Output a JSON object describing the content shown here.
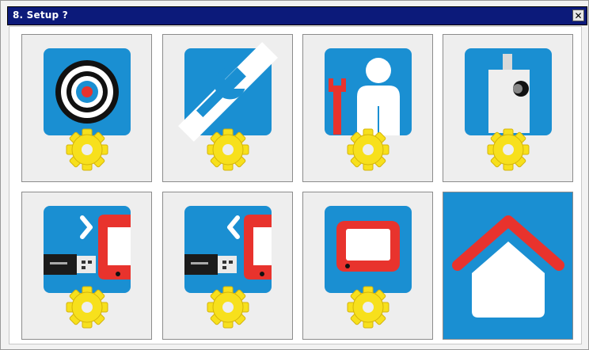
{
  "window": {
    "title": "8. Setup ?",
    "close_glyph": "✕"
  },
  "colors": {
    "title_bar": "#0c1a7a",
    "icon_blue": "#1a8fd2",
    "accent_red": "#e8332d",
    "gear_yellow": "#f7e01c"
  },
  "tiles": [
    {
      "icon": "target-gear-icon"
    },
    {
      "icon": "wrench-gear-icon"
    },
    {
      "icon": "user-wrench-gear-icon"
    },
    {
      "icon": "camera-gear-icon"
    },
    {
      "icon": "usb-export-gear-icon"
    },
    {
      "icon": "usb-import-gear-icon"
    },
    {
      "icon": "screen-gear-icon"
    },
    {
      "icon": "home-icon"
    }
  ]
}
